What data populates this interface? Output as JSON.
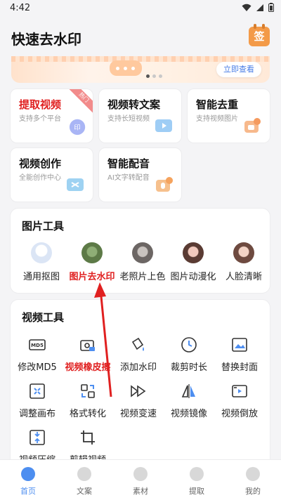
{
  "status": {
    "time": "4:42"
  },
  "header": {
    "title": "快速去水印",
    "sign_label": "签"
  },
  "banner": {
    "cta": "立即查看"
  },
  "feature_cards": [
    {
      "title": "提取视频",
      "subtitle": "支持多个平台",
      "badge": "热门",
      "highlight": true,
      "icon": "video-extract-icon",
      "icon_color": "#a9b5f5"
    },
    {
      "title": "视频转文案",
      "subtitle": "支持长短视频",
      "icon": "video-text-icon",
      "icon_color": "#9ecdf5"
    },
    {
      "title": "智能去重",
      "subtitle": "支持视频图片",
      "icon": "dedupe-icon",
      "icon_color": "#f7b98c"
    },
    {
      "title": "视频创作",
      "subtitle": "全能创作中心",
      "icon": "create-icon",
      "icon_color": "#9ed2f2"
    },
    {
      "title": "智能配音",
      "subtitle": "AI文字转配音",
      "icon": "dubbing-icon",
      "icon_color": "#f6c08d"
    }
  ],
  "image_tools": {
    "title": "图片工具",
    "items": [
      {
        "label": "通用抠图",
        "icon": "cutout-avatar"
      },
      {
        "label": "图片去水印",
        "highlight": true,
        "icon": "watermark-avatar"
      },
      {
        "label": "老照片上色",
        "icon": "colorize-avatar"
      },
      {
        "label": "图片动漫化",
        "icon": "anime-avatar"
      },
      {
        "label": "人脸清晰",
        "icon": "face-avatar"
      }
    ]
  },
  "video_tools": {
    "title": "视频工具",
    "items": [
      {
        "label": "修改MD5",
        "icon": "md5-icon"
      },
      {
        "label": "视频橡皮擦",
        "highlight": true,
        "icon": "eraser-icon"
      },
      {
        "label": "添加水印",
        "icon": "add-watermark-icon"
      },
      {
        "label": "裁剪时长",
        "icon": "clock-icon"
      },
      {
        "label": "替换封面",
        "icon": "cover-icon"
      },
      {
        "label": "调整画布",
        "icon": "canvas-icon"
      },
      {
        "label": "格式转化",
        "icon": "convert-icon"
      },
      {
        "label": "视频变速",
        "icon": "speed-icon"
      },
      {
        "label": "视频镜像",
        "icon": "mirror-icon"
      },
      {
        "label": "视频倒放",
        "icon": "reverse-icon"
      },
      {
        "label": "视频压缩",
        "icon": "compress-icon"
      },
      {
        "label": "剪辑视频",
        "icon": "crop-icon"
      }
    ]
  },
  "tabbar": [
    {
      "label": "首页",
      "active": true,
      "icon": "home-icon"
    },
    {
      "label": "文案",
      "icon": "text-icon"
    },
    {
      "label": "素材",
      "icon": "material-icon"
    },
    {
      "label": "提取",
      "icon": "extract-icon"
    },
    {
      "label": "我的",
      "icon": "profile-icon"
    }
  ],
  "colors": {
    "accent": "#4d8ef0",
    "highlight": "#e02020",
    "annotation_arrow": "#e02020",
    "sign": "#f39a48"
  }
}
